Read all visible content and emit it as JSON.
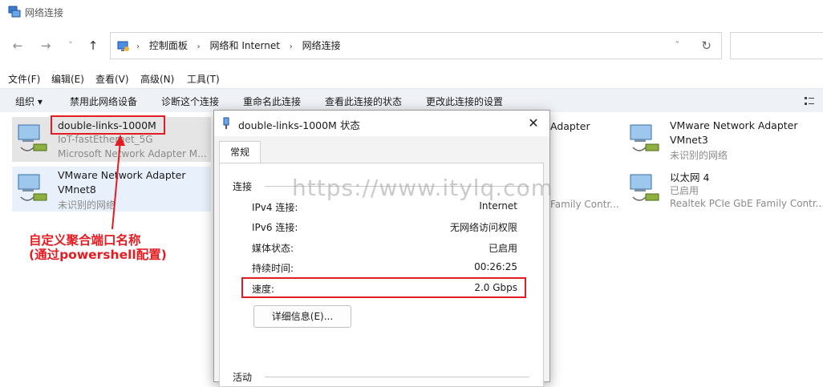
{
  "window": {
    "title": "网络连接"
  },
  "nav": {
    "back": "←",
    "forward": "→",
    "recent": "˅",
    "up": "↑"
  },
  "address": {
    "crumbs": [
      "控制面板",
      "网络和 Internet",
      "网络连接"
    ],
    "sep": "›",
    "dropdown": "˅",
    "refresh": "↻"
  },
  "menu": [
    "文件(F)",
    "编辑(E)",
    "查看(V)",
    "高级(N)",
    "工具(T)"
  ],
  "commands": [
    "组织 ▾",
    "禁用此网络设备",
    "诊断这个连接",
    "重命名此连接",
    "查看此连接的状态",
    "更改此连接的设置"
  ],
  "adapters": [
    {
      "name": "double-links-1000M",
      "status": "IoT-fastEthernet_5G",
      "device": "Microsoft Network Adapter M..."
    },
    {
      "name": "VMware Network Adapter VMnet8",
      "name2": "",
      "status": "未识别的网络",
      "device": ""
    },
    {
      "name": "Adapter",
      "device": "Family Contr..."
    },
    {
      "name": "VMware Network Adapter VMnet3",
      "status": "未识别的网络"
    },
    {
      "name": "以太网 4",
      "status": "已启用",
      "device": "Realtek PCIe GbE Family Contr..."
    }
  ],
  "dialog": {
    "title": "double-links-1000M 状态",
    "close": "✕",
    "tab": "常规",
    "group_connection": "连接",
    "rows": [
      {
        "label": "IPv4 连接:",
        "value": "Internet"
      },
      {
        "label": "IPv6 连接:",
        "value": "无网络访问权限"
      },
      {
        "label": "媒体状态:",
        "value": "已启用"
      },
      {
        "label": "持续时间:",
        "value": "00:26:25"
      },
      {
        "label": "速度:",
        "value": "2.0 Gbps"
      }
    ],
    "details_button": "详细信息(E)...",
    "group_activity": "活动"
  },
  "annotation": {
    "line1": "自定义聚合端口名称",
    "line2": "(通过powershell配置)"
  },
  "watermark": "https://www.itylq.com",
  "colors": {
    "annotation_red": "#e21c22",
    "command_bar": "#eef1f6"
  }
}
